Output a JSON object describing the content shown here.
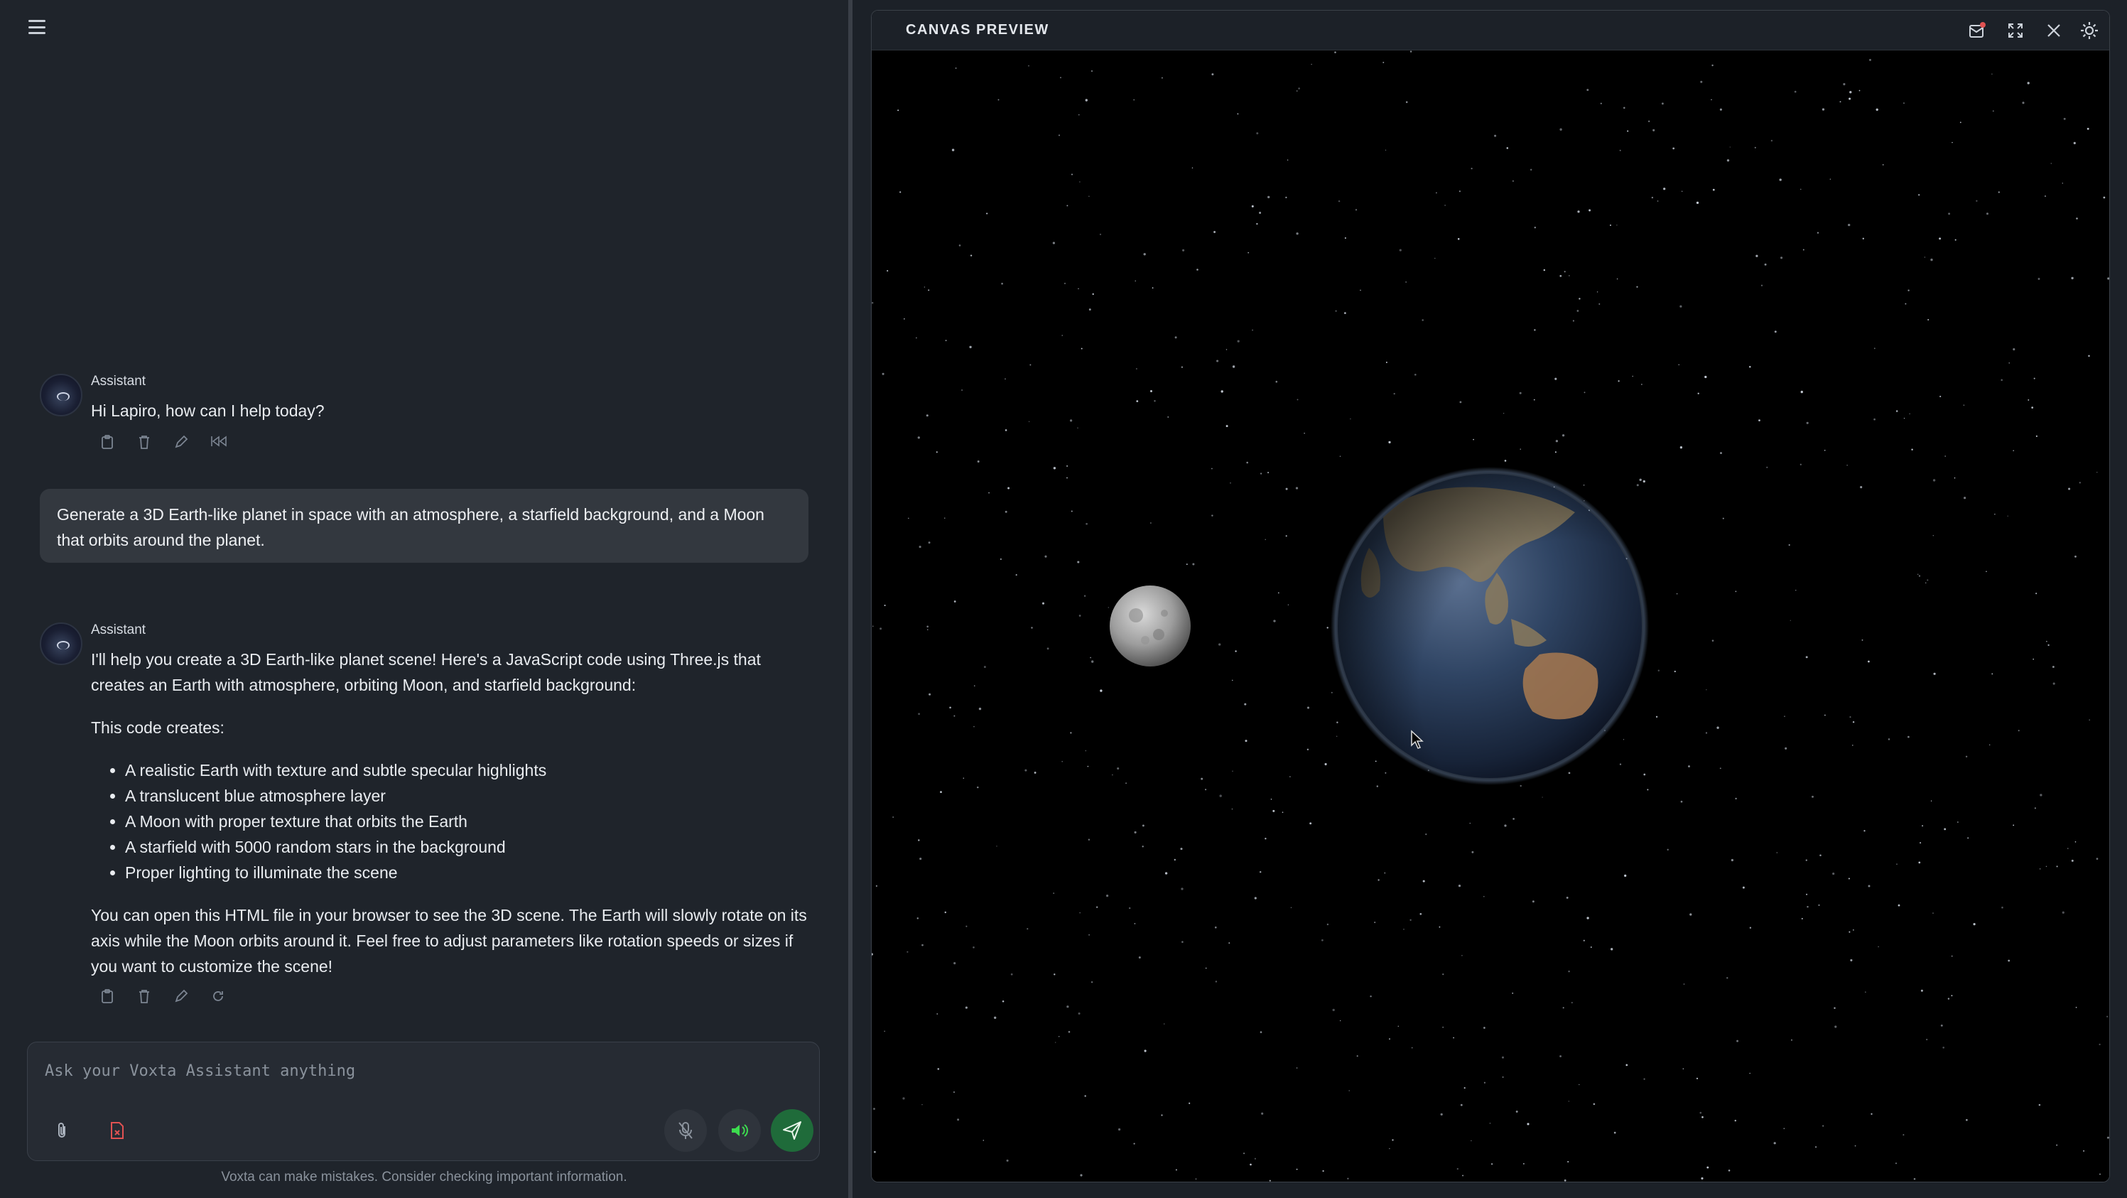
{
  "chat": {
    "messages": [
      {
        "role": "Assistant",
        "text": "Hi Lapiro, how can I help today?"
      },
      {
        "role": "user",
        "text": "Generate a 3D Earth-like planet in space with an atmosphere, a starfield background, and a Moon that orbits around the planet."
      },
      {
        "role": "Assistant",
        "intro": "I'll help you create a 3D Earth-like planet scene! Here's a JavaScript code using Three.js that creates an Earth with atmosphere, orbiting Moon, and starfield background:",
        "subheading": "This code creates:",
        "bullets": [
          "A realistic Earth with texture and subtle specular highlights",
          "A translucent blue atmosphere layer",
          "A Moon with proper texture that orbits the Earth",
          "A starfield with 5000 random stars in the background",
          "Proper lighting to illuminate the scene"
        ],
        "outro": "You can open this HTML file in your browser to see the 3D scene. The Earth will slowly rotate on its axis while the Moon orbits around it. Feel free to adjust parameters like rotation speeds or sizes if you want to customize the scene!"
      }
    ],
    "composer": {
      "placeholder": "Ask your Voxta Assistant anything"
    },
    "disclaimer": "Voxta can make mistakes. Consider checking important information."
  },
  "canvas": {
    "title": "CANVAS PREVIEW"
  },
  "colors": {
    "send": "#1f6b3a",
    "speaker_on": "#3ddc4f",
    "file_icon": "#e05252"
  },
  "icons": {
    "menu": "hamburger-icon",
    "copy": "clipboard-icon",
    "delete": "trash-icon",
    "edit": "pencil-icon",
    "rewind": "rewind-icon",
    "regenerate": "refresh-icon",
    "attach": "paperclip-icon",
    "file": "file-x-icon",
    "mic": "mic-off-icon",
    "speaker": "speaker-icon",
    "send": "send-icon",
    "notify": "notification-icon",
    "fullscreen": "fullscreen-icon",
    "close": "close-icon",
    "settings": "gear-icon"
  }
}
